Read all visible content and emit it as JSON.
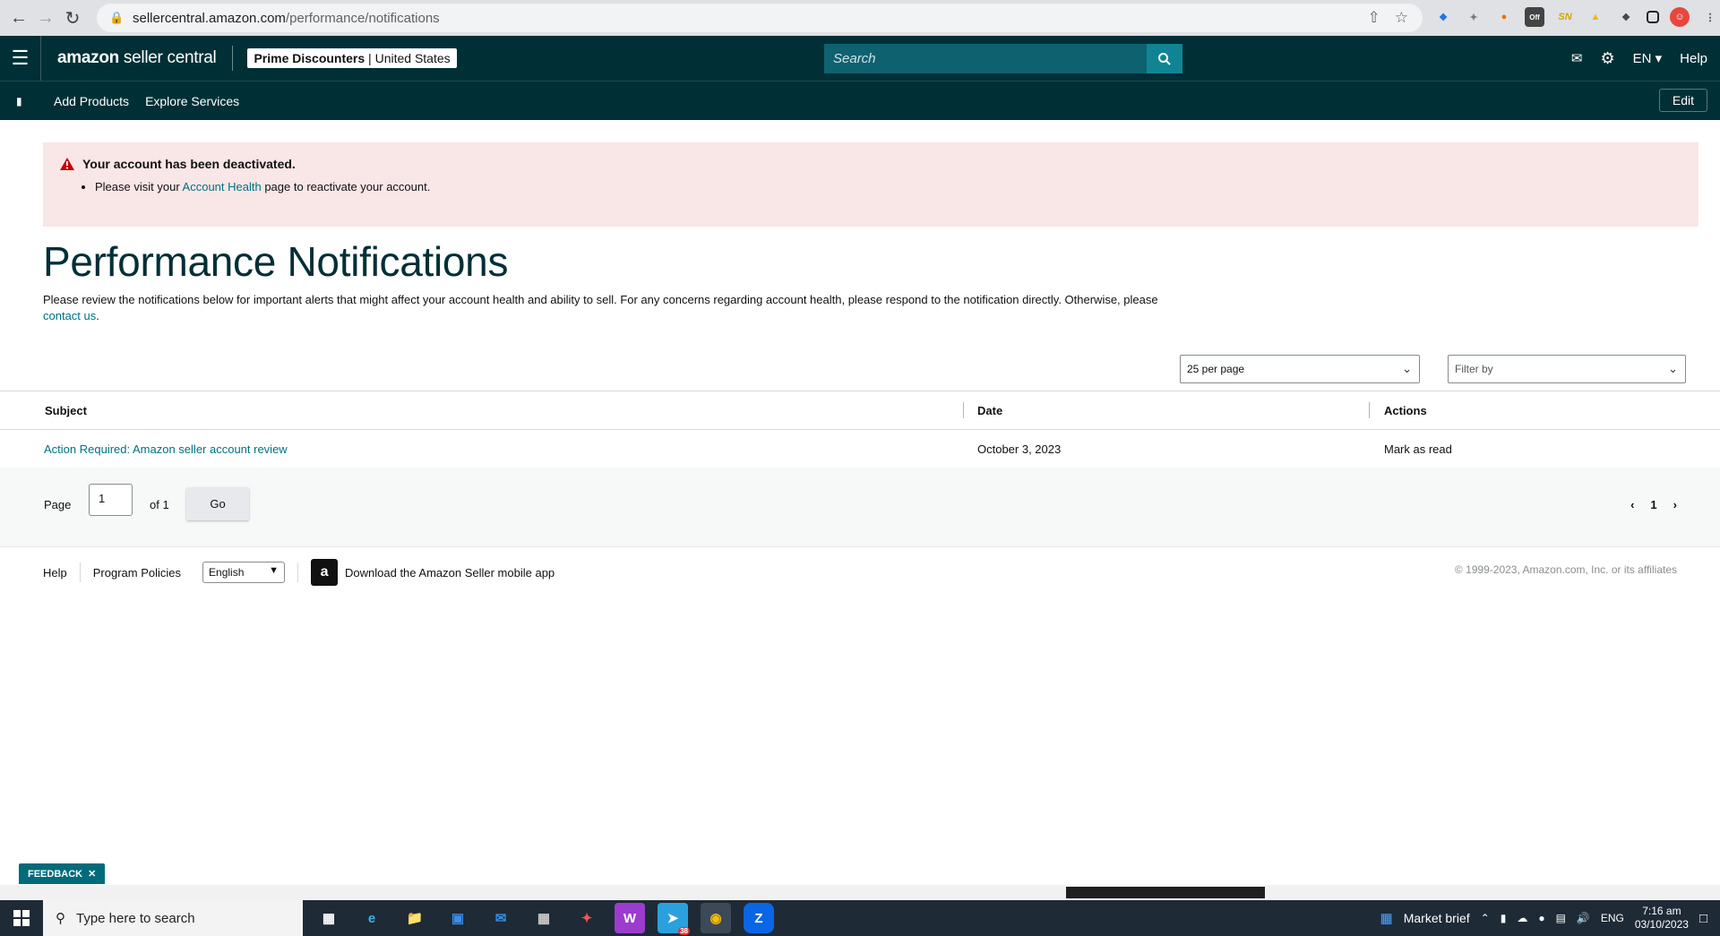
{
  "browser": {
    "url_host": "sellercentral.amazon.com",
    "url_path": "/performance/notifications"
  },
  "header": {
    "logo_bold": "amazon",
    "logo_rest": " seller central",
    "store_name": "Prime Discounters",
    "store_sep": " | ",
    "store_region": "United States",
    "search_placeholder": "Search",
    "language": "EN",
    "help": "Help"
  },
  "subnav": {
    "items": [
      "Add Products",
      "Explore Services"
    ],
    "edit": "Edit"
  },
  "alert": {
    "title": "Your account has been deactivated.",
    "body_before": "Please visit your ",
    "body_link": "Account Health",
    "body_after": " page to reactivate your account."
  },
  "page": {
    "title": "Performance Notifications",
    "intro_text": "Please review the notifications below for important alerts that might affect your account health and ability to sell. For any concerns regarding account health, please respond to the notification directly. Otherwise, please ",
    "intro_link": "contact us",
    "intro_end": "."
  },
  "controls": {
    "per_page": "25 per page",
    "filter_placeholder": "Filter by"
  },
  "table": {
    "columns": [
      "Subject",
      "Date",
      "Actions"
    ],
    "rows": [
      {
        "subject": "Action Required: Amazon seller account review",
        "date": "October 3, 2023",
        "action": "Mark as read"
      }
    ]
  },
  "pager": {
    "page_label": "Page",
    "page_value": "1",
    "of_label": "of 1",
    "go": "Go",
    "current": "1"
  },
  "footer": {
    "help": "Help",
    "policies": "Program Policies",
    "language": "English",
    "app_text": "Download the Amazon Seller mobile app",
    "copyright": "© 1999-2023, Amazon.com, Inc. or its affiliates"
  },
  "feedback": "FEEDBACK",
  "taskbar": {
    "search_placeholder": "Type here to search",
    "news": "Market brief",
    "lang": "ENG",
    "time": "7:16 am",
    "date": "03/10/2023",
    "chat_badge": "38"
  },
  "colors": {
    "header_bg": "#002f36",
    "alert_bg": "#f9e6e7",
    "link": "#007185",
    "alert_icon": "#c40000"
  }
}
